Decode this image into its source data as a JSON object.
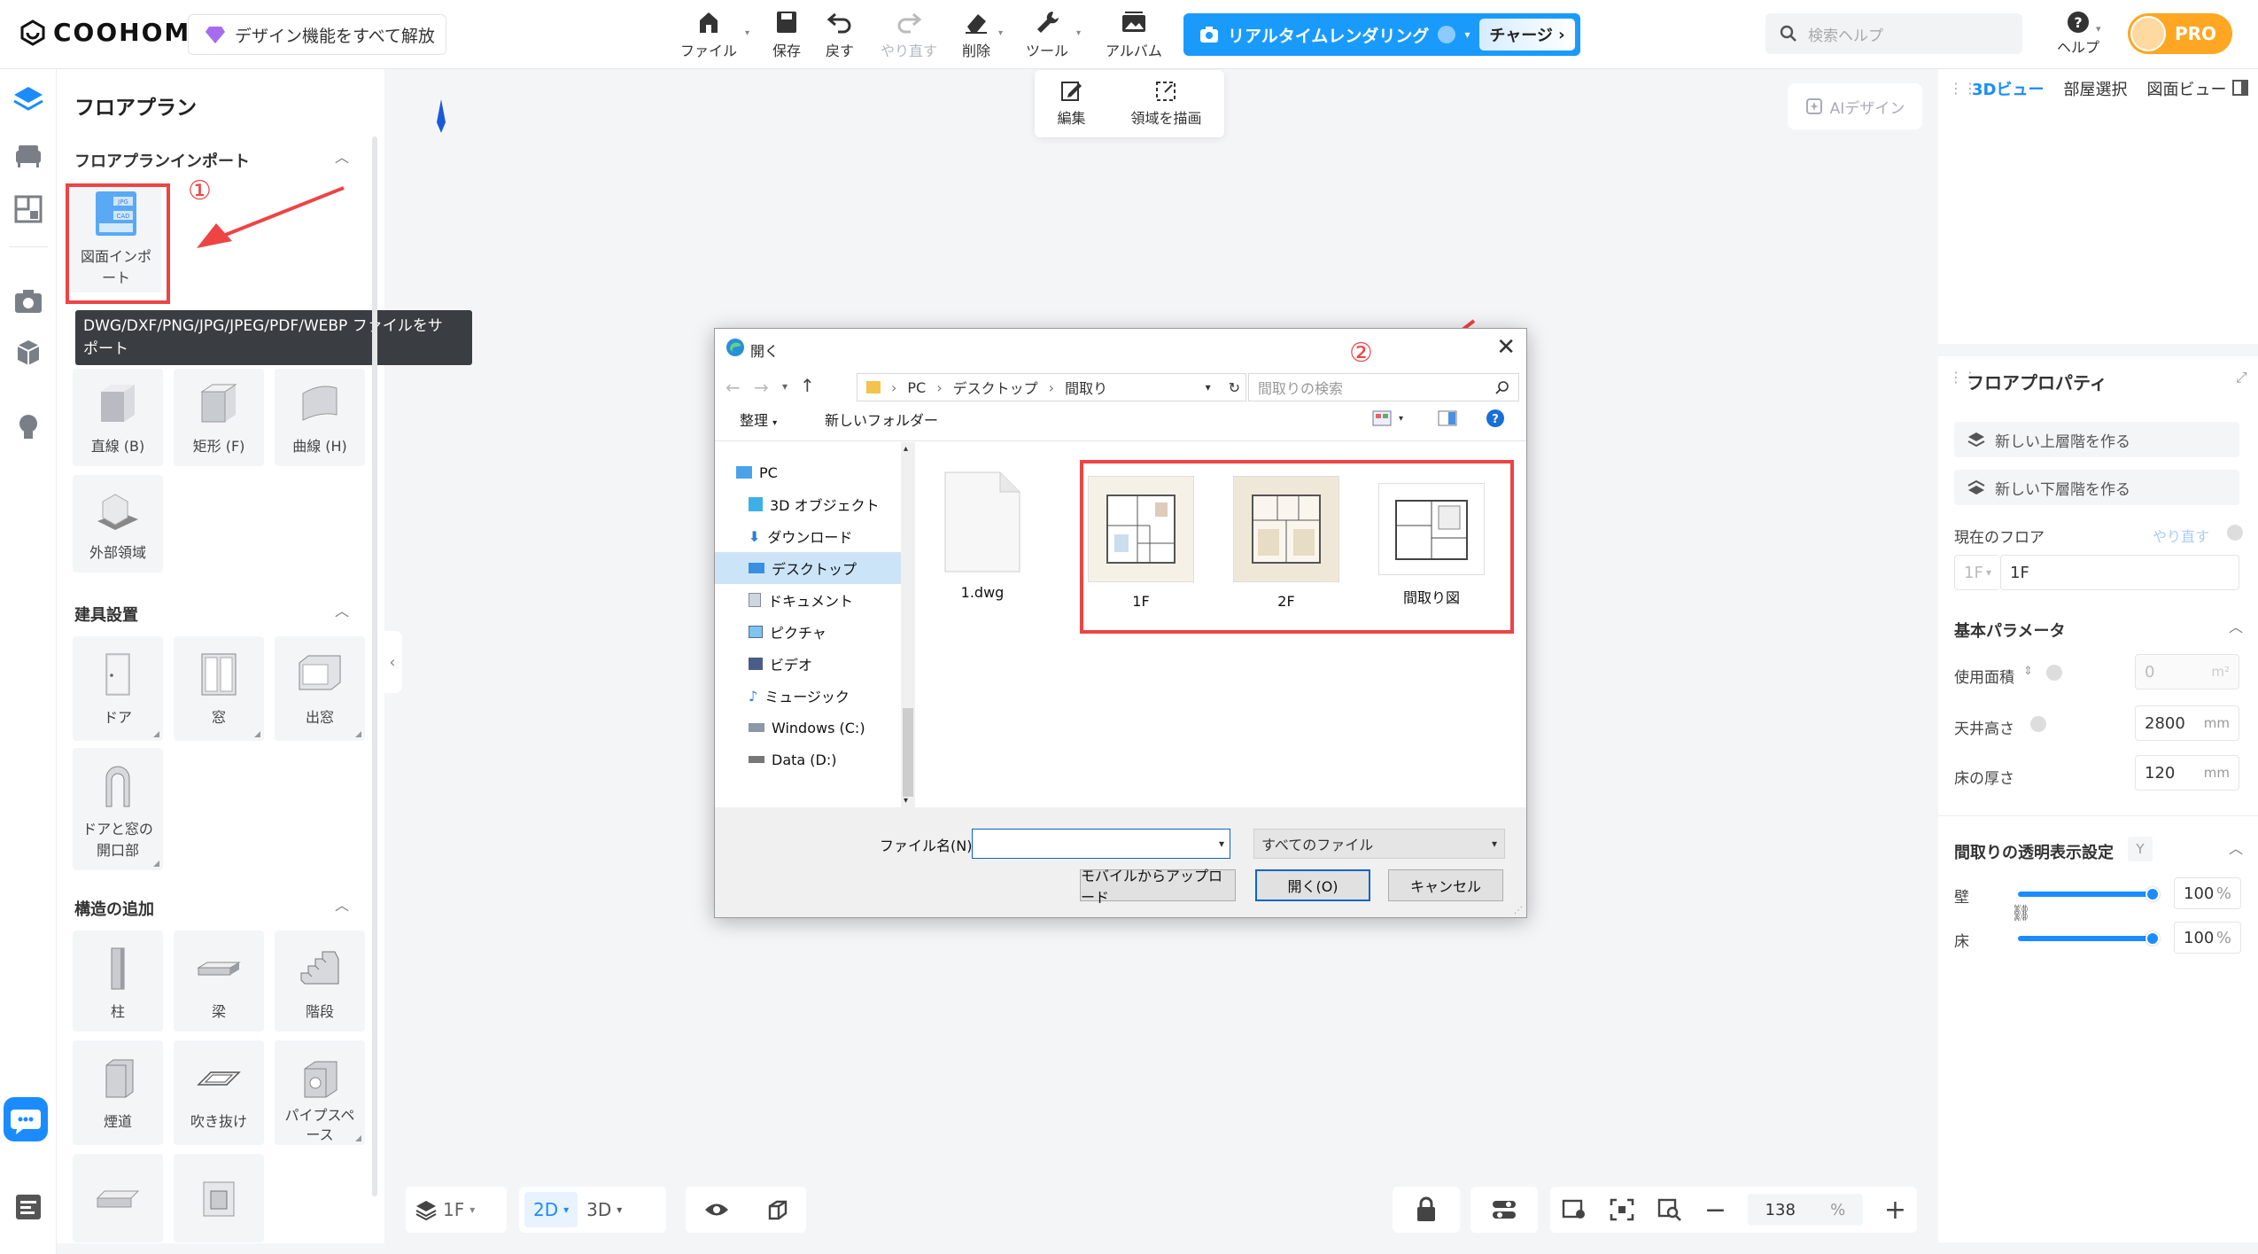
{
  "brand": {
    "name": "COOHOM",
    "unlock": "デザイン機能をすべて解放"
  },
  "toolbar": {
    "file": "ファイル",
    "save": "保存",
    "undo": "戻す",
    "redo": "やり直す",
    "delete": "削除",
    "tools": "ツール",
    "album": "アルバム",
    "render": "リアルタイムレンダリング",
    "charge": "チャージ",
    "search_placeholder": "検索ヘルプ",
    "help": "ヘルプ",
    "pro": "PRO"
  },
  "edit_popup": {
    "edit": "編集",
    "draw_area": "領域を描画"
  },
  "ai_design": "AIデザイン",
  "panel": {
    "title": "フロアプラン",
    "import_section": "フロアプランインポート",
    "import_card": [
      "図面インポ",
      "ート"
    ],
    "import_badge_jpg": "JPG",
    "import_badge_cad": "CAD",
    "tooltip": [
      "DWG/DXF/PNG/JPG/JPEG/PDF/WEBP ファイルをサ",
      "ポート"
    ],
    "walls": [
      "直線 (B)",
      "矩形 (F)",
      "曲線 (H)",
      "外部領域"
    ],
    "fixtures_section": "建具設置",
    "fixtures": [
      "ドア",
      "窓",
      "出窓"
    ],
    "opening": [
      "ドアと窓の",
      "開口部"
    ],
    "structure_section": "構造の追加",
    "structures": [
      "柱",
      "梁",
      "階段",
      "煙道",
      "吹き抜け"
    ],
    "pipe": [
      "パイプスペ",
      "ース"
    ]
  },
  "annotations": {
    "one": "①",
    "two": "②"
  },
  "bottom": {
    "floor": "1F",
    "mode_2d": "2D",
    "mode_3d": "3D",
    "zoom": "138",
    "zoom_unit": "%"
  },
  "right": {
    "tabs": [
      "3Dビュー",
      "部屋選択",
      "図面ビュー"
    ],
    "props_title": "フロアプロパティ",
    "new_upper": "新しい上層階を作る",
    "new_lower": "新しい下層階を作る",
    "current_floor": "現在のフロア",
    "redo": "やり直す",
    "floor_prefix": "1F",
    "floor_name": "1F",
    "basic": "基本パラメータ",
    "area_label": "使用面積",
    "area_value": "0",
    "area_unit": "m²",
    "ceiling_label": "天井高さ",
    "ceiling_value": "2800",
    "ceiling_unit": "mm",
    "floor_thick_label": "床の厚さ",
    "floor_thick_value": "120",
    "floor_thick_unit": "mm",
    "transparency": "間取りの透明表示設定",
    "transparency_key": "Y",
    "wall": "壁",
    "wall_value": "100",
    "wall_unit": "%",
    "floor": "床",
    "floor_value": "100",
    "floor_unit": "%"
  },
  "dialog": {
    "title": "開く",
    "path": [
      "PC",
      "デスクトップ",
      "間取り"
    ],
    "search_placeholder": "間取りの検索",
    "organize": "整理",
    "new_folder": "新しいフォルダー",
    "tree": [
      "PC",
      "3D オブジェクト",
      "ダウンロード",
      "デスクトップ",
      "ドキュメント",
      "ピクチャ",
      "ビデオ",
      "ミュージック",
      "Windows (C:)",
      "Data (D:)"
    ],
    "files": [
      "1.dwg",
      "1F",
      "2F",
      "間取り図"
    ],
    "filename_label": "ファイル名(N):",
    "filename_value": "",
    "filetype": "すべてのファイル",
    "mobile_upload": "モバイルからアップロード",
    "open": "開く(O)",
    "cancel": "キャンセル"
  }
}
